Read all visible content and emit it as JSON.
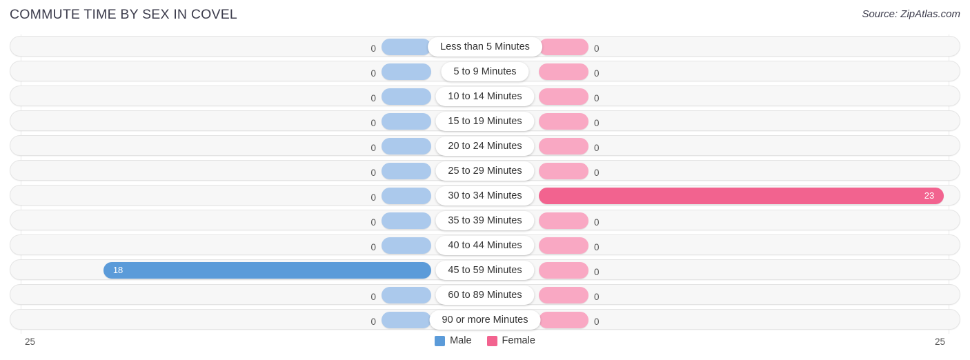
{
  "header": {
    "title": "COMMUTE TIME BY SEX IN COVEL",
    "source": "Source: ZipAtlas.com"
  },
  "axis": {
    "left_label": "25",
    "right_label": "25"
  },
  "legend": {
    "items": [
      {
        "label": "Male",
        "color": "#5b9bd9",
        "swatch_name": "legend-swatch-male"
      },
      {
        "label": "Female",
        "color": "#f2638f",
        "swatch_name": "legend-swatch-female"
      }
    ]
  },
  "colors": {
    "male_active": "#5b9bd9",
    "male_zero": "#abc9ec",
    "female_active": "#f2638f",
    "female_zero": "#f9a8c3",
    "row_track": "#f7f7f7",
    "row_border": "#e4e4e4",
    "gridline": "#e9e9e9",
    "title_text": "#3c3c4c"
  },
  "chart_data": {
    "type": "bar",
    "title": "COMMUTE TIME BY SEX IN COVEL",
    "subtitle": "Source: ZipAtlas.com",
    "orientation": "horizontal-diverging",
    "xlabel": "",
    "ylabel": "",
    "xlim": [
      25,
      25
    ],
    "axis_max_left": 25,
    "axis_max_right": 25,
    "grid": false,
    "legend_position": "bottom-center",
    "categories": [
      "Less than 5 Minutes",
      "5 to 9 Minutes",
      "10 to 14 Minutes",
      "15 to 19 Minutes",
      "20 to 24 Minutes",
      "25 to 29 Minutes",
      "30 to 34 Minutes",
      "35 to 39 Minutes",
      "40 to 44 Minutes",
      "45 to 59 Minutes",
      "60 to 89 Minutes",
      "90 or more Minutes"
    ],
    "series": [
      {
        "name": "Male",
        "color": "#5b9bd9",
        "values": [
          0,
          0,
          0,
          0,
          0,
          0,
          0,
          0,
          0,
          18,
          0,
          0
        ],
        "labels": [
          "0",
          "0",
          "0",
          "0",
          "0",
          "0",
          "0",
          "0",
          "0",
          "18",
          "0",
          "0"
        ]
      },
      {
        "name": "Female",
        "color": "#f2638f",
        "values": [
          0,
          0,
          0,
          0,
          0,
          0,
          23,
          0,
          0,
          0,
          0,
          0
        ],
        "labels": [
          "0",
          "0",
          "0",
          "0",
          "0",
          "0",
          "23",
          "0",
          "0",
          "0",
          "0",
          "0"
        ]
      }
    ]
  }
}
